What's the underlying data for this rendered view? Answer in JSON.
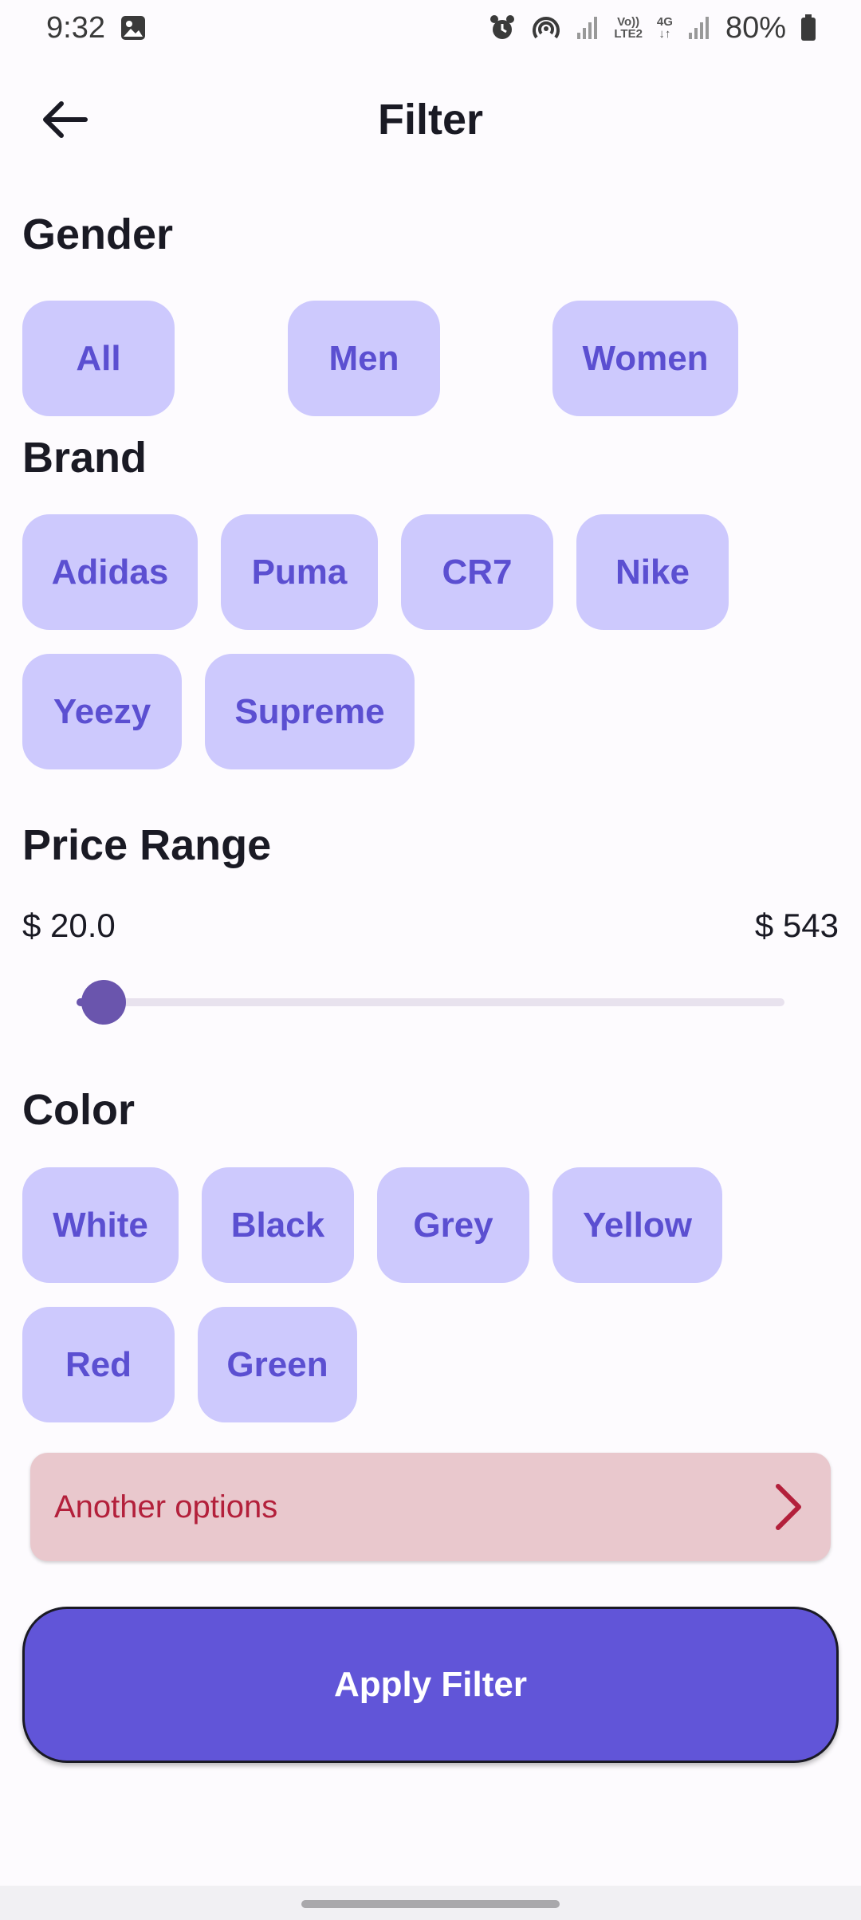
{
  "status_bar": {
    "time": "9:32",
    "net_line1": "Vo))",
    "net_line2": "LTE2",
    "net_type": "4G",
    "battery": "80%"
  },
  "app_bar": {
    "title": "Filter"
  },
  "sections": {
    "gender": "Gender",
    "brand": "Brand",
    "price": "Price Range",
    "color": "Color"
  },
  "gender_options": [
    "All",
    "Men",
    "Women"
  ],
  "brand_options": [
    "Adidas",
    "Puma",
    "CR7",
    "Nike",
    "Yeezy",
    "Supreme"
  ],
  "price": {
    "min_label": "$ 20.0",
    "max_label": "$ 543",
    "slider_value": 20,
    "slider_min": 20,
    "slider_max": 543
  },
  "color_options": [
    "White",
    "Black",
    "Grey",
    "Yellow",
    "Red",
    "Green"
  ],
  "another_options": "Another options",
  "apply_label": "Apply Filter",
  "colors": {
    "chip_bg": "#cdc9fd",
    "chip_text": "#5b4fd1",
    "accent": "#6155d8",
    "slider": "#6a55ad",
    "options_bg": "#e9c8cd",
    "options_text": "#b3203b"
  }
}
